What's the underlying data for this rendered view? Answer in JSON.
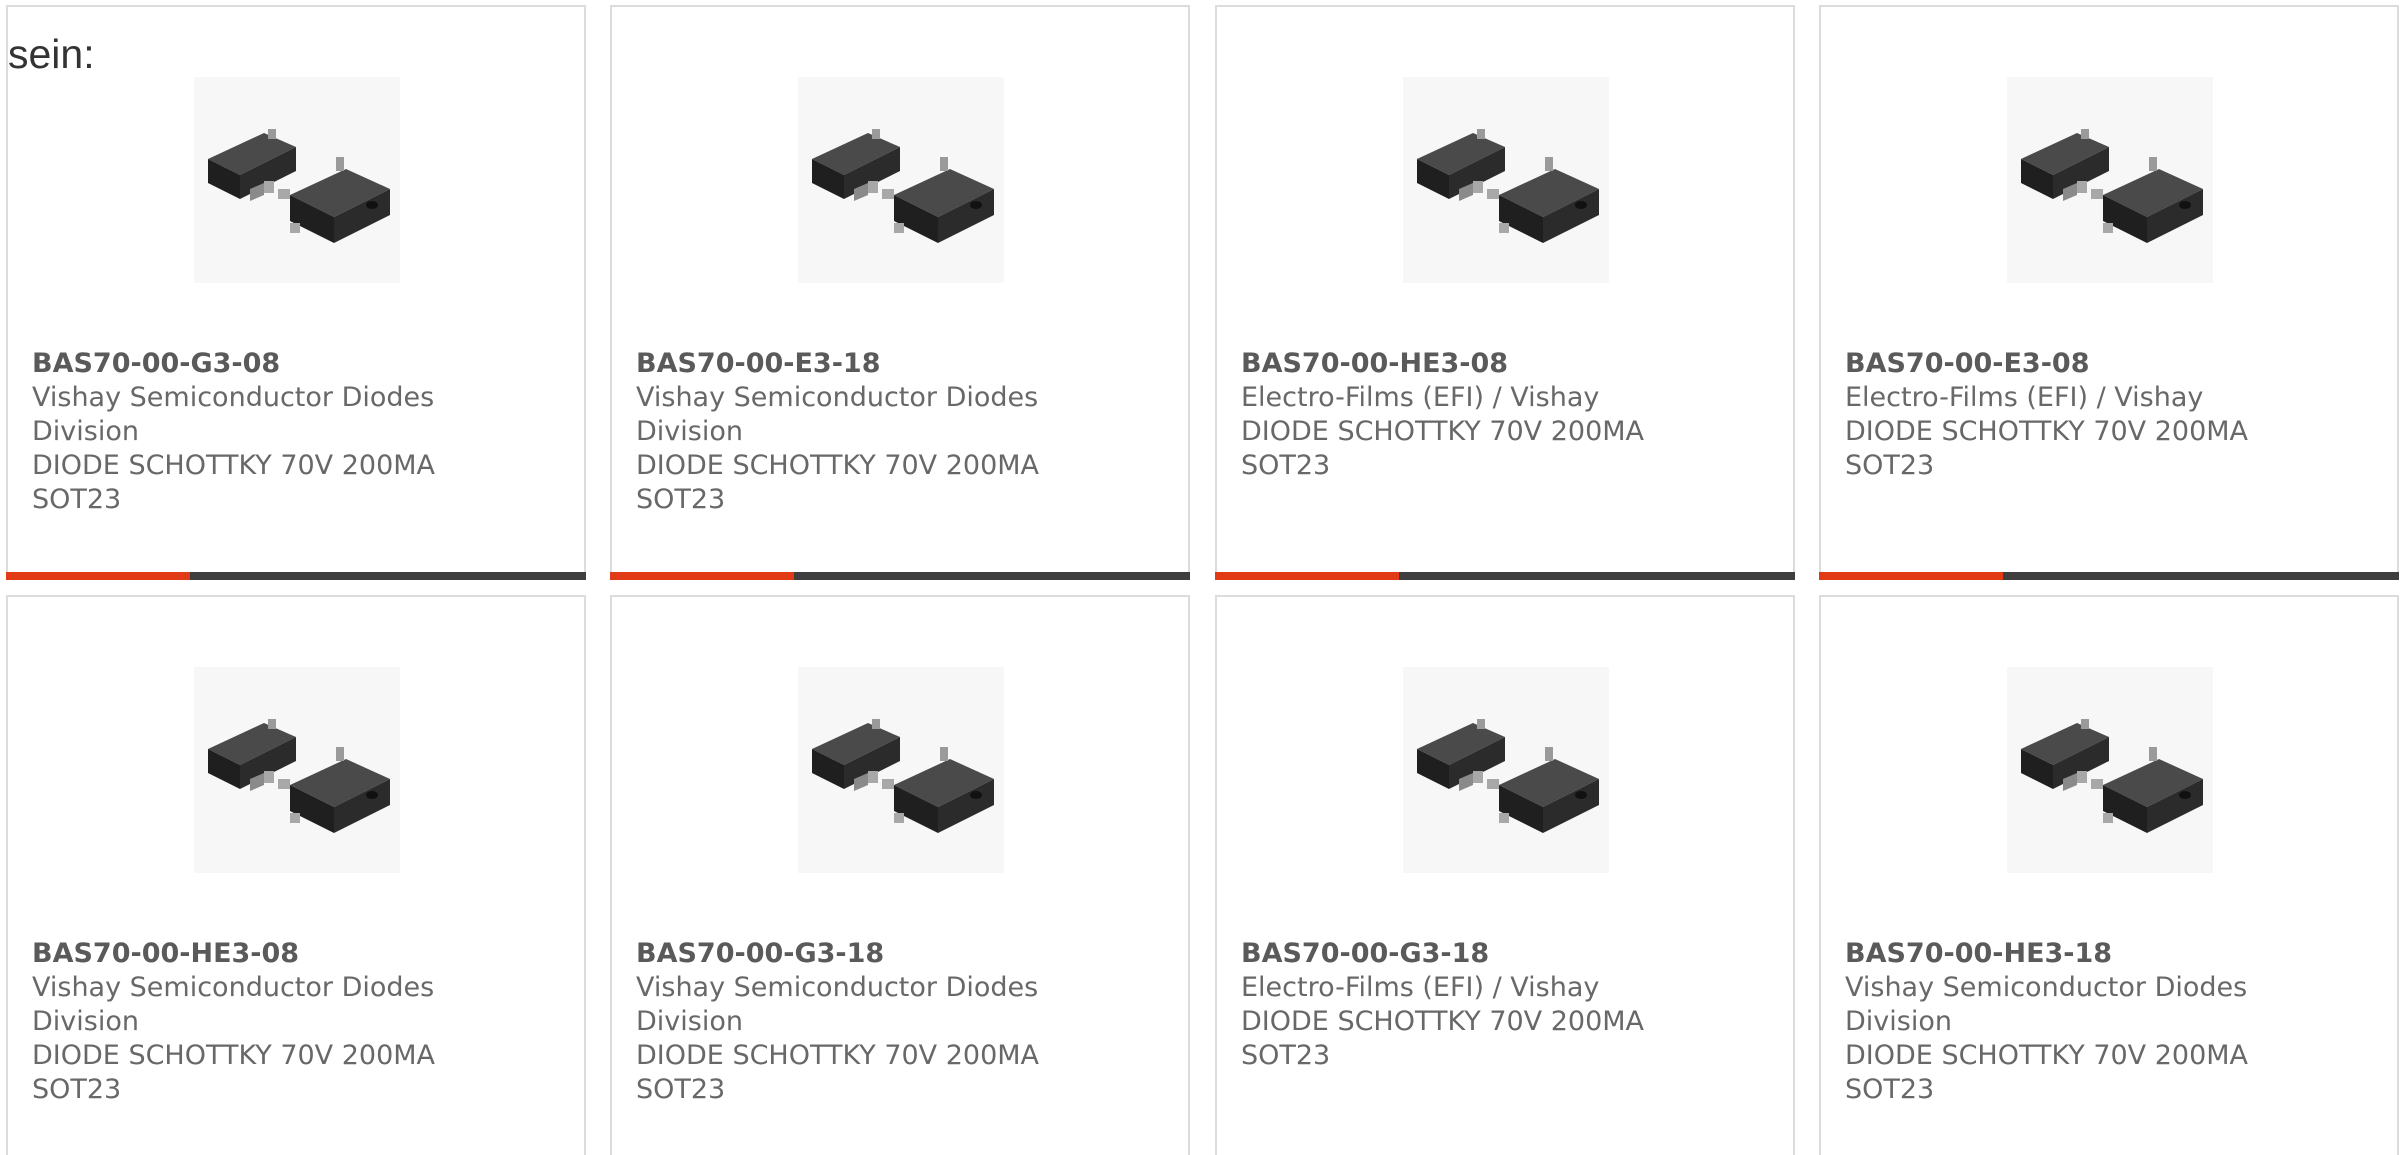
{
  "intro_text": "sein:",
  "colors": {
    "accent": "#e03a16",
    "bar": "#3e3e3e",
    "border": "#dcdcdc",
    "text": "#686868"
  },
  "products": [
    {
      "part": "BAS70-00-G3-08",
      "maker_1": "Vishay Semiconductor Diodes",
      "maker_2": "Division",
      "desc": "DIODE SCHOTTKY 70V 200MA",
      "pkg": "SOT23",
      "image_icon": "sot23-diode-icon"
    },
    {
      "part": "BAS70-00-E3-18",
      "maker_1": "Vishay Semiconductor Diodes",
      "maker_2": "Division",
      "desc": "DIODE SCHOTTKY 70V 200MA",
      "pkg": "SOT23",
      "image_icon": "sot23-diode-icon"
    },
    {
      "part": "BAS70-00-HE3-08",
      "maker_1": "Electro-Films (EFI) / Vishay",
      "maker_2": "",
      "desc": "DIODE SCHOTTKY 70V 200MA",
      "pkg": "SOT23",
      "image_icon": "sot23-diode-icon"
    },
    {
      "part": "BAS70-00-E3-08",
      "maker_1": "Electro-Films (EFI) / Vishay",
      "maker_2": "",
      "desc": "DIODE SCHOTTKY 70V 200MA",
      "pkg": "SOT23",
      "image_icon": "sot23-diode-icon"
    },
    {
      "part": "BAS70-00-HE3-08",
      "maker_1": "Vishay Semiconductor Diodes",
      "maker_2": "Division",
      "desc": "DIODE SCHOTTKY 70V 200MA",
      "pkg": "SOT23",
      "image_icon": "sot23-diode-icon"
    },
    {
      "part": "BAS70-00-G3-18",
      "maker_1": "Vishay Semiconductor Diodes",
      "maker_2": "Division",
      "desc": "DIODE SCHOTTKY 70V 200MA",
      "pkg": "SOT23",
      "image_icon": "sot23-diode-icon"
    },
    {
      "part": "BAS70-00-G3-18",
      "maker_1": "Electro-Films (EFI) / Vishay",
      "maker_2": "",
      "desc": "DIODE SCHOTTKY 70V 200MA",
      "pkg": "SOT23",
      "image_icon": "sot23-diode-icon"
    },
    {
      "part": "BAS70-00-HE3-18",
      "maker_1": "Vishay Semiconductor Diodes",
      "maker_2": "Division",
      "desc": "DIODE SCHOTTKY 70V 200MA",
      "pkg": "SOT23",
      "image_icon": "sot23-diode-icon"
    }
  ]
}
